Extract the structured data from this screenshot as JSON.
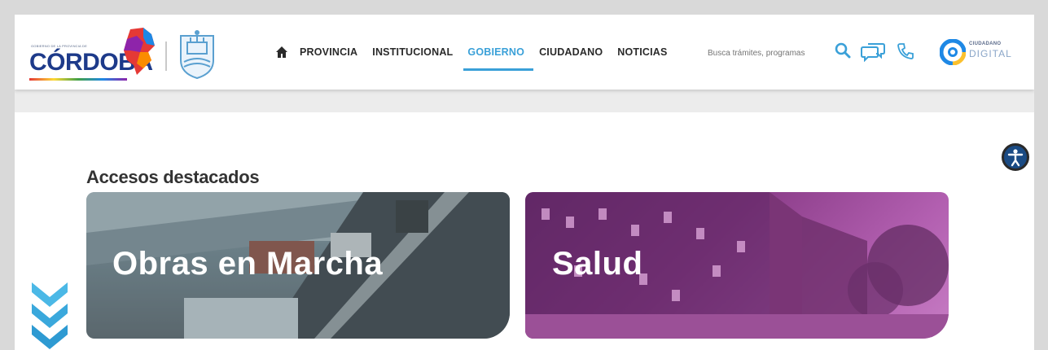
{
  "header": {
    "logo_small_text": "GOBIERNO DE LA PROVINCIA DE",
    "logo_text": "CÓRDOBA",
    "nav": [
      {
        "label": "PROVINCIA",
        "active": false
      },
      {
        "label": "INSTITUCIONAL",
        "active": false
      },
      {
        "label": "GOBIERNO",
        "active": true
      },
      {
        "label": "CIUDADANO",
        "active": false
      },
      {
        "label": "NOTICIAS",
        "active": false
      }
    ],
    "search_placeholder": "Busca trámites, programas",
    "cd_line1": "CIUDADANO",
    "cd_line2": "DIGITAL"
  },
  "main": {
    "section_title": "Accesos destacados",
    "cards": [
      {
        "label": "Obras en Marcha"
      },
      {
        "label": "Salud"
      }
    ]
  },
  "colors": {
    "accent": "#3aa0d8",
    "brand_blue": "#1d3a8a",
    "salud_purple": "#8a3c88",
    "accessibility": "#1a4b84"
  },
  "icons": [
    "home-icon",
    "search-icon",
    "chat-icon",
    "phone-icon",
    "ciudadano-digital-icon",
    "accessibility-icon",
    "scroll-down-icon"
  ]
}
